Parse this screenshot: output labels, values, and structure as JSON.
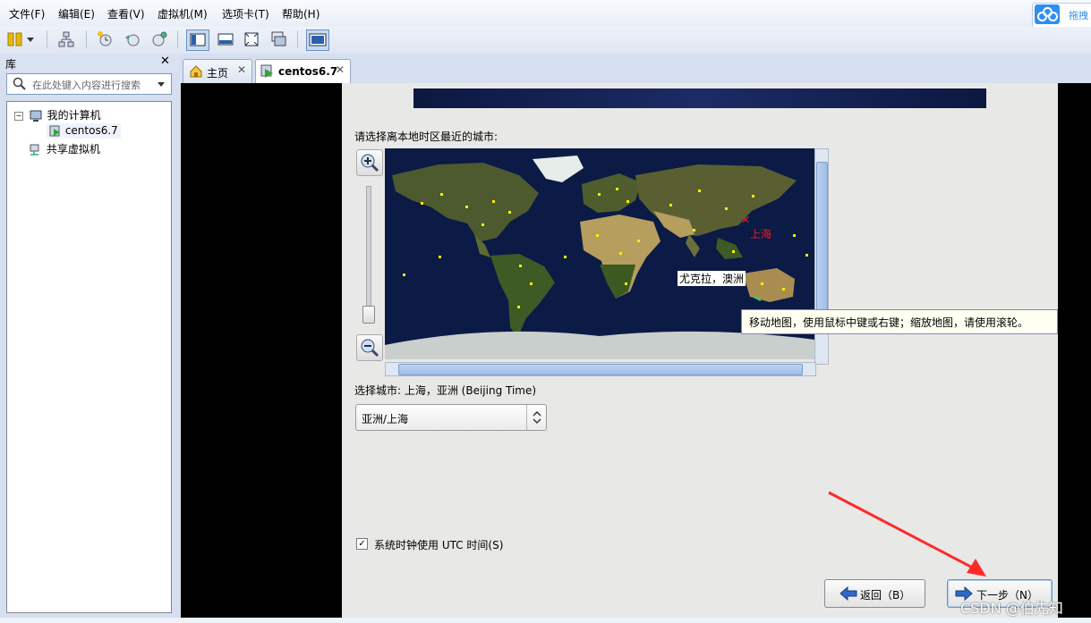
{
  "menu": [
    "文件(F)",
    "编辑(E)",
    "查看(V)",
    "虚拟机(M)",
    "选项卡(T)",
    "帮助(H)"
  ],
  "cloud_button": {
    "label": "拖拽",
    "icon": "cloud-drive-icon"
  },
  "toolbar": {
    "icons": [
      "pause-power-icon",
      "dropdown-icon",
      "network-icon",
      "snapshot-icon",
      "revert-snapshot-icon",
      "snapshot-manager-icon",
      "console-view-icon",
      "fullscreen-view-icon",
      "fit-view-icon",
      "unity-view-icon",
      "thumbnail-view-icon"
    ]
  },
  "library": {
    "title": "库",
    "search_placeholder": "在此处键入内容进行搜索",
    "tree": {
      "root": "我的计算机",
      "vm": "centos6.7",
      "shared": "共享虚拟机"
    }
  },
  "tabs": [
    {
      "label": "主页",
      "icon": "home-icon"
    },
    {
      "label": "centos6.7",
      "icon": "vm-running-icon",
      "active": true
    }
  ],
  "installer": {
    "prompt": "请选择离本地时区最近的城市:",
    "map": {
      "hover_city": "尤克拉，澳洲",
      "selected_city_marker": "上海",
      "tooltip": "移动地图，使用鼠标中键或右键；缩放地图，请使用滚轮。"
    },
    "selected_city_text": "选择城市: 上海，亚洲 (Beijing Time)",
    "timezone_value": "亚洲/上海",
    "utc_checkbox": {
      "label": "系统时钟使用 UTC 时间(S)",
      "checked": true
    },
    "back_button": "返回（B）",
    "next_button": "下一步（N）"
  },
  "watermark": "CSDN @伯先知",
  "colors": {
    "accent": "#2f8ff0",
    "map_sea": "#0c1a46",
    "marker": "#e02020",
    "arrow": "#ff2a2a"
  }
}
